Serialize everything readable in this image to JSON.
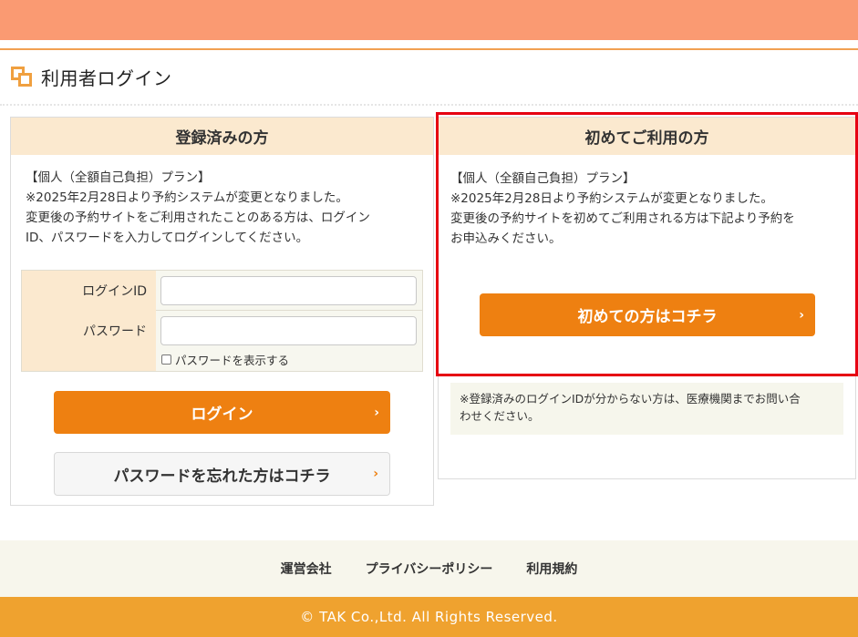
{
  "page": {
    "title": "利用者ログイン"
  },
  "left_panel": {
    "header": "登録済みの方",
    "notice": [
      "【個人（全額自己負担）プラン】",
      "※2025年2月28日より予約システムが変更となりました。",
      "変更後の予約サイトをご利用されたことのある方は、ログイン",
      "ID、パスワードを入力してログインしてください。"
    ],
    "form": {
      "login_id_label": "ログインID",
      "login_id_value": "",
      "password_label": "パスワード",
      "password_value": "",
      "show_password_label": "パスワードを表示する"
    },
    "login_button": "ログイン",
    "forgot_button": "パスワードを忘れた方はコチラ"
  },
  "right_panel": {
    "header": "初めてご利用の方",
    "notice": [
      "【個人（全額自己負担）プラン】",
      "※2025年2月28日より予約システムが変更となりました。",
      "変更後の予約サイトを初めてご利用される方は下記より予約を",
      "お申込みください。"
    ],
    "first_time_button": "初めての方はコチラ",
    "info_note": [
      "※登録済みのログインIDが分からない方は、医療機関までお問い合",
      "わせください。"
    ]
  },
  "footer": {
    "links": [
      "運営会社",
      "プライバシーポリシー",
      "利用規約"
    ],
    "copyright": "© TAK Co.,Ltd. All Rights Reserved."
  },
  "icons": {
    "chevron": "›",
    "heading_icon": "overlapping-squares-icon"
  },
  "colors": {
    "accent_orange": "#ee8011",
    "header_salmon": "#fa9a72",
    "panel_header_bg": "#fbe9cf",
    "copyright_bg": "#efa22f",
    "highlight_red": "#e60012"
  }
}
